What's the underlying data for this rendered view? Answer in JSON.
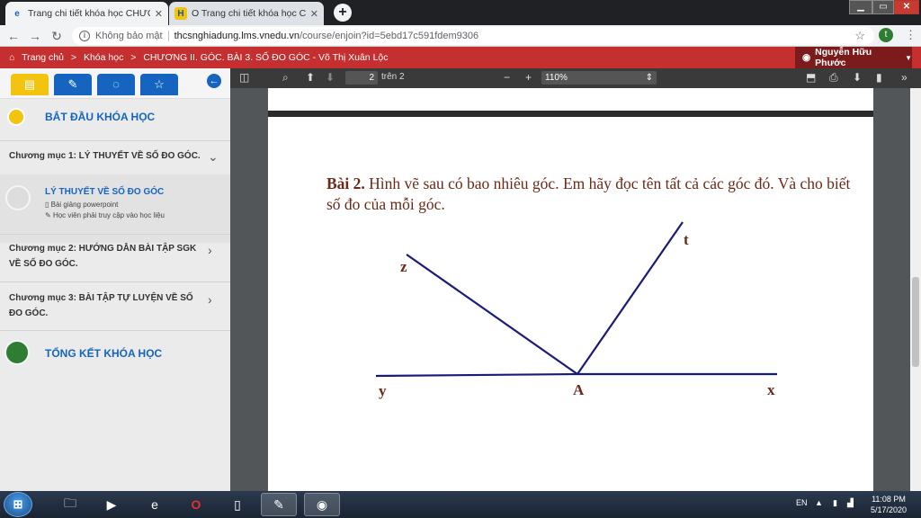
{
  "browser": {
    "tabs": [
      {
        "title": "Trang chi tiết khóa học CHƯƠNG II",
        "active": true,
        "favicon_color": "#1565c0"
      },
      {
        "title": "O Trang chi tiết khóa học CHƯƠNG",
        "active": false,
        "favicon_color": "#f2c40f",
        "favicon_text": "H"
      }
    ],
    "new_tab": "+",
    "address": {
      "security_label": "Không bảo mật",
      "host": "thcsnghiadung.lms.vnedu.vn",
      "path": "/course/enjoin?id=5ebd17c591fdem9306"
    },
    "profile_initial": "t"
  },
  "site": {
    "breadcrumb": [
      "Trang chủ",
      "Khóa học",
      "CHƯƠNG II. GÓC. BÀI 3. SỐ ĐO GÓC - Võ Thị Xuân Lộc"
    ],
    "separator": ">",
    "user_name": "Nguyễn Hữu Phước"
  },
  "sidebar": {
    "start_label": "BẮT ĐẦU KHÓA HỌC",
    "chapters": [
      {
        "label": "Chương mục 1: LÝ THUYẾT VỀ SỐ ĐO GÓC.",
        "expanded": true
      },
      {
        "label": "Chương mục 2: HƯỚNG DẪN BÀI TẬP SGK VỀ SỐ ĐO GÓC.",
        "expanded": false
      },
      {
        "label": "Chương mục 3: BÀI TẬP TỰ LUYỆN VỀ SỐ ĐO GÓC.",
        "expanded": false
      }
    ],
    "lesson": {
      "title": "LÝ THUYẾT VỀ SỐ ĐO GÓC",
      "type": "Bài giảng powerpoint",
      "note": "Học viên phải truy cập vào học liệu"
    },
    "end_label": "TỔNG KẾT KHÓA HỌC",
    "colors": {
      "start": "#f2c40f",
      "end": "#2e7d32",
      "accent": "#1565c0"
    }
  },
  "pdf": {
    "page_current": "2",
    "page_total_label": "trên 2",
    "zoom": "110%",
    "problem_number": "Bài 2.",
    "problem_text": "Hình vẽ sau có bao nhiêu góc. Em hãy đọc tên tất cả các góc đó. Và cho biết số đo của mỗi góc.",
    "figure_labels": {
      "z": "z",
      "t": "t",
      "y": "y",
      "A": "A",
      "x": "x"
    },
    "line_color": "#1a1a7a"
  },
  "taskbar": {
    "language": "EN",
    "time": "11:08 PM",
    "date": "5/17/2020"
  }
}
